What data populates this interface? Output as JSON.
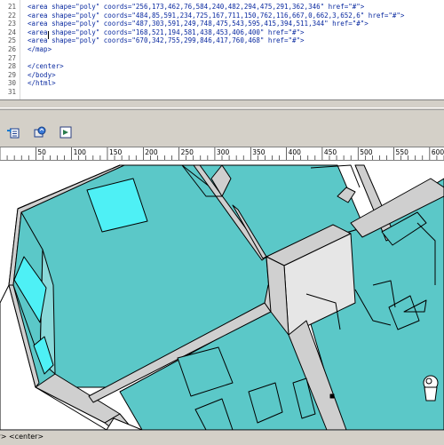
{
  "editor": {
    "lines": [
      {
        "num": "21",
        "text": "<area shape=\"poly\" coords=\"256,173,462,76,584,240,482,294,475,291,362,346\" href=\"#\">"
      },
      {
        "num": "22",
        "text": "<area shape=\"poly\" coords=\"484,85,591,234,725,167,711,150,762,116,667,0,662,3,652,6\" href=\"#\">"
      },
      {
        "num": "23",
        "text": "<area shape=\"poly\" coords=\"487,303,591,249,748,475,543,595,415,394,511,344\" href=\"#\">"
      },
      {
        "num": "24",
        "text": "<area shape=\"poly\" coords=\"168,521,194,581,438,453,406,400\" href=\"#\">"
      },
      {
        "num": "25",
        "text": "<area shape=\"poly\" coords=\"670,342,755,299,846,417,760,468\" href=\"#\">"
      },
      {
        "num": "26",
        "text": "</map>"
      },
      {
        "num": "27",
        "text": ""
      },
      {
        "num": "28",
        "text": "</center>"
      },
      {
        "num": "29",
        "text": "</body>"
      },
      {
        "num": "30",
        "text": "</html>"
      },
      {
        "num": "31",
        "text": ""
      }
    ]
  },
  "toolbar": {
    "icons": [
      "insert-tag-icon",
      "refresh-design-icon",
      "view-options-icon"
    ]
  },
  "ruler": {
    "ticks": [
      "50",
      "100",
      "150",
      "200",
      "250",
      "300",
      "350",
      "400",
      "450",
      "500",
      "550",
      "600"
    ]
  },
  "status": {
    "tag_path": "y> <center>"
  },
  "colors": {
    "floor": "#5bc8c8",
    "window": "#4ef0f5",
    "wall_top": "#cfcfcf",
    "outline": "#000000"
  }
}
